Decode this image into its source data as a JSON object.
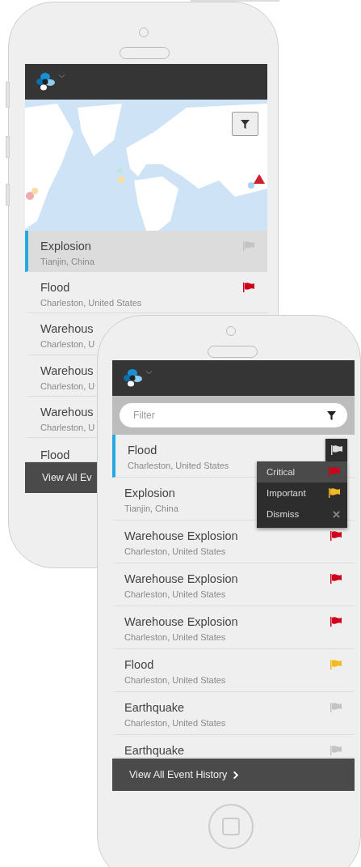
{
  "back_phone": {
    "events": [
      {
        "title": "Explosion",
        "location": "Tianjin, China",
        "color": "#c4c4c4",
        "selected": true
      },
      {
        "title": "Flood",
        "location": "Charleston, United States",
        "color": "#d0021b",
        "selected": false
      },
      {
        "title": "Warehous",
        "location": "Charleston, U",
        "selected": false
      },
      {
        "title": "Warehous",
        "location": "Charleston, U",
        "selected": false
      },
      {
        "title": "Warehous",
        "location": "Charleston, U",
        "selected": false
      },
      {
        "title": "Flood",
        "selected": false
      }
    ],
    "footer_label": "View All Ev"
  },
  "front_phone": {
    "filter": {
      "placeholder": "Filter"
    },
    "events": [
      {
        "title": "Flood",
        "location": "Charleston, United States",
        "color": "#dddddd",
        "selected": true,
        "menu_open": true
      },
      {
        "title": "Explosion",
        "location": "Tianjin, China",
        "selected": false,
        "menu_open": false
      },
      {
        "title": "Warehouse Explosion",
        "location": "Charleston, United States",
        "color": "#d0021b",
        "selected": false,
        "menu_open": false
      },
      {
        "title": "Warehouse Explosion",
        "location": "Charleston, United States",
        "color": "#d0021b",
        "selected": false,
        "menu_open": false
      },
      {
        "title": "Warehouse Explosion",
        "location": "Charleston, United States",
        "color": "#d0021b",
        "selected": false,
        "menu_open": false
      },
      {
        "title": "Flood",
        "location": "Charleston, United States",
        "color": "#f5b921",
        "selected": false,
        "menu_open": false
      },
      {
        "title": "Earthquake",
        "location": "Charleston, United States",
        "color": "#c4c4c4",
        "selected": false,
        "menu_open": false
      },
      {
        "title": "Earthquake",
        "color": "#c4c4c4",
        "selected": false,
        "menu_open": false
      }
    ],
    "flag_menu": {
      "items": [
        {
          "label": "Critical",
          "kind": "critical",
          "selected": true
        },
        {
          "label": "Important",
          "kind": "important",
          "selected": false
        },
        {
          "label": "Dismiss",
          "kind": "dismiss",
          "selected": false
        }
      ]
    },
    "footer_label": "View All Event History"
  }
}
